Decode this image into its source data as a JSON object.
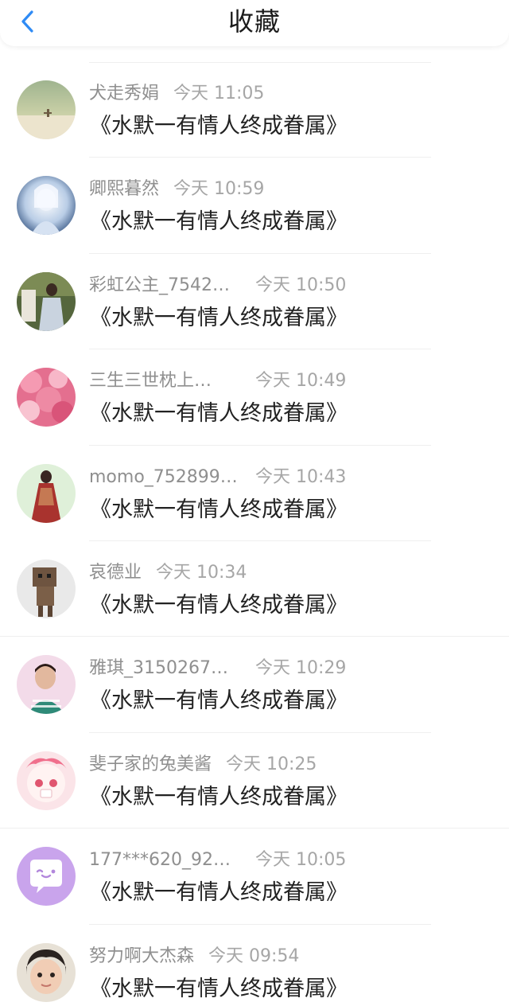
{
  "header": {
    "title": "收藏",
    "back_icon": "chevron-left-icon",
    "accent_color": "#2f8bf5"
  },
  "items": [
    {
      "username": "犬走秀娟",
      "time": "今天 11:05",
      "content": "《水默一有情人终成眷属》"
    },
    {
      "username": "卿熙暮然",
      "time": "今天 10:59",
      "content": "《水默一有情人终成眷属》"
    },
    {
      "username": "彩虹公主_7542…",
      "time": "今天 10:50",
      "content": "《水默一有情人终成眷属》"
    },
    {
      "username": "三生三世枕上…",
      "time": "今天 10:49",
      "content": "《水默一有情人终成眷属》"
    },
    {
      "username": "momo_752899…",
      "time": "今天 10:43",
      "content": "《水默一有情人终成眷属》"
    },
    {
      "username": "哀德业",
      "time": "今天 10:34",
      "content": "《水默一有情人终成眷属》"
    },
    {
      "username": "雅琪_3150267…",
      "time": "今天 10:29",
      "content": "《水默一有情人终成眷属》"
    },
    {
      "username": "斐子家的兔美酱",
      "time": "今天 10:25",
      "content": "《水默一有情人终成眷属》"
    },
    {
      "username": "177***620_928…",
      "time": "今天 10:05",
      "content": "《水默一有情人终成眷属》"
    },
    {
      "username": "努力啊大杰森",
      "time": "今天 09:54",
      "content": "《水默一有情人终成眷属》"
    }
  ]
}
